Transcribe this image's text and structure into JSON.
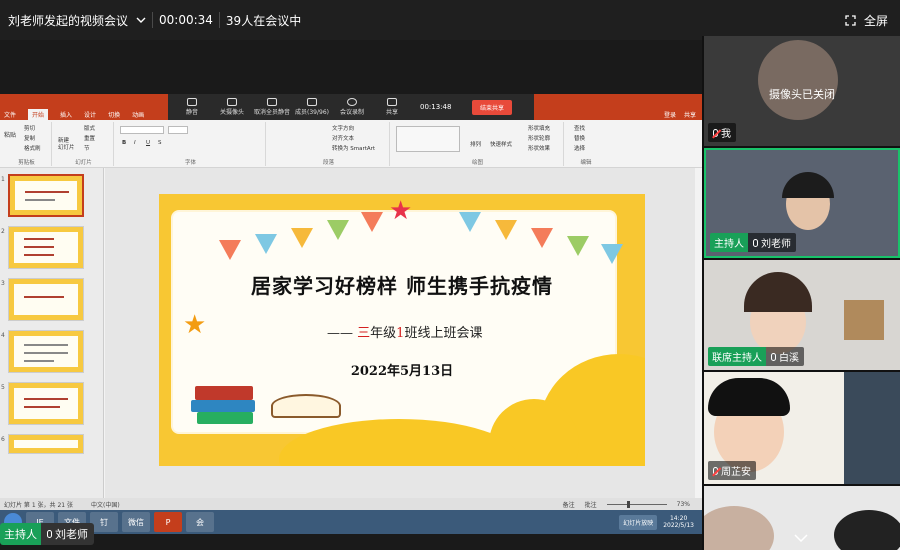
{
  "meeting": {
    "title": "刘老师发起的视频会议",
    "timer": "00:00:34",
    "participants": "39人在会议中",
    "fullscreen_label": "全屏"
  },
  "share_toolbar": {
    "items": [
      "静音",
      "关摄像头",
      "取消全员静音",
      "成员(39/96)",
      "会议录制",
      "共享"
    ],
    "time": "00:13:48",
    "end_share_label": "结束共享"
  },
  "ppt": {
    "tabs": [
      "文件",
      "开始",
      "插入",
      "设计",
      "切换",
      "动画"
    ],
    "active_tab": "开始",
    "right_links": [
      "登录",
      "共享"
    ],
    "ribbon": {
      "clipboard": {
        "label": "剪贴板",
        "paste": "粘贴",
        "cut": "剪切",
        "copy": "复制",
        "format": "格式刷"
      },
      "slides": {
        "label": "幻灯片",
        "new": "新建\n幻灯片",
        "layout": "版式",
        "reset": "重置",
        "section": "节"
      },
      "font": {
        "label": "字体"
      },
      "paragraph": {
        "label": "段落",
        "text_dir": "文字方向",
        "align_text": "对齐文本",
        "smartart": "转换为 SmartArt"
      },
      "drawing": {
        "label": "绘图",
        "arrange": "排列",
        "quick_styles": "快速样式",
        "fill": "形状填充",
        "outline": "形状轮廓",
        "effects": "形状效果"
      },
      "editing": {
        "label": "编辑",
        "find": "查找",
        "replace": "替换",
        "select": "选择"
      }
    },
    "thumb_numbers": [
      "1",
      "2",
      "3",
      "4",
      "5",
      "6"
    ],
    "status": {
      "slide_info": "幻灯片 第 1 张，共 21 张",
      "language": "中文(中国)",
      "notes": "备注",
      "comments": "批注",
      "zoom": "73%"
    }
  },
  "slide": {
    "title": "居家学习好榜样  师生携手抗疫情",
    "subtitle_prefix": "—— ",
    "subtitle_num1": "三",
    "subtitle_mid": "年级",
    "subtitle_num2": "1",
    "subtitle_suffix": "班线上班会课",
    "date": "2022年5月13日"
  },
  "taskbar": {
    "apps": [
      "IE",
      "文件",
      "钉",
      "微信",
      "P",
      "会"
    ],
    "tray_label": "幻灯片放映",
    "time": "14:20",
    "date": "2022/5/13"
  },
  "bottom_badge": {
    "role": "主持人",
    "name": "刘老师"
  },
  "tiles": [
    {
      "name": "我",
      "role": "",
      "camera_off": "摄像头已关闭",
      "muted": true
    },
    {
      "name": "刘老师",
      "role": "主持人",
      "muted": false
    },
    {
      "name": "白溪",
      "role": "联席主持人",
      "muted": false
    },
    {
      "name": "周芷安",
      "role": "",
      "muted": true
    }
  ]
}
